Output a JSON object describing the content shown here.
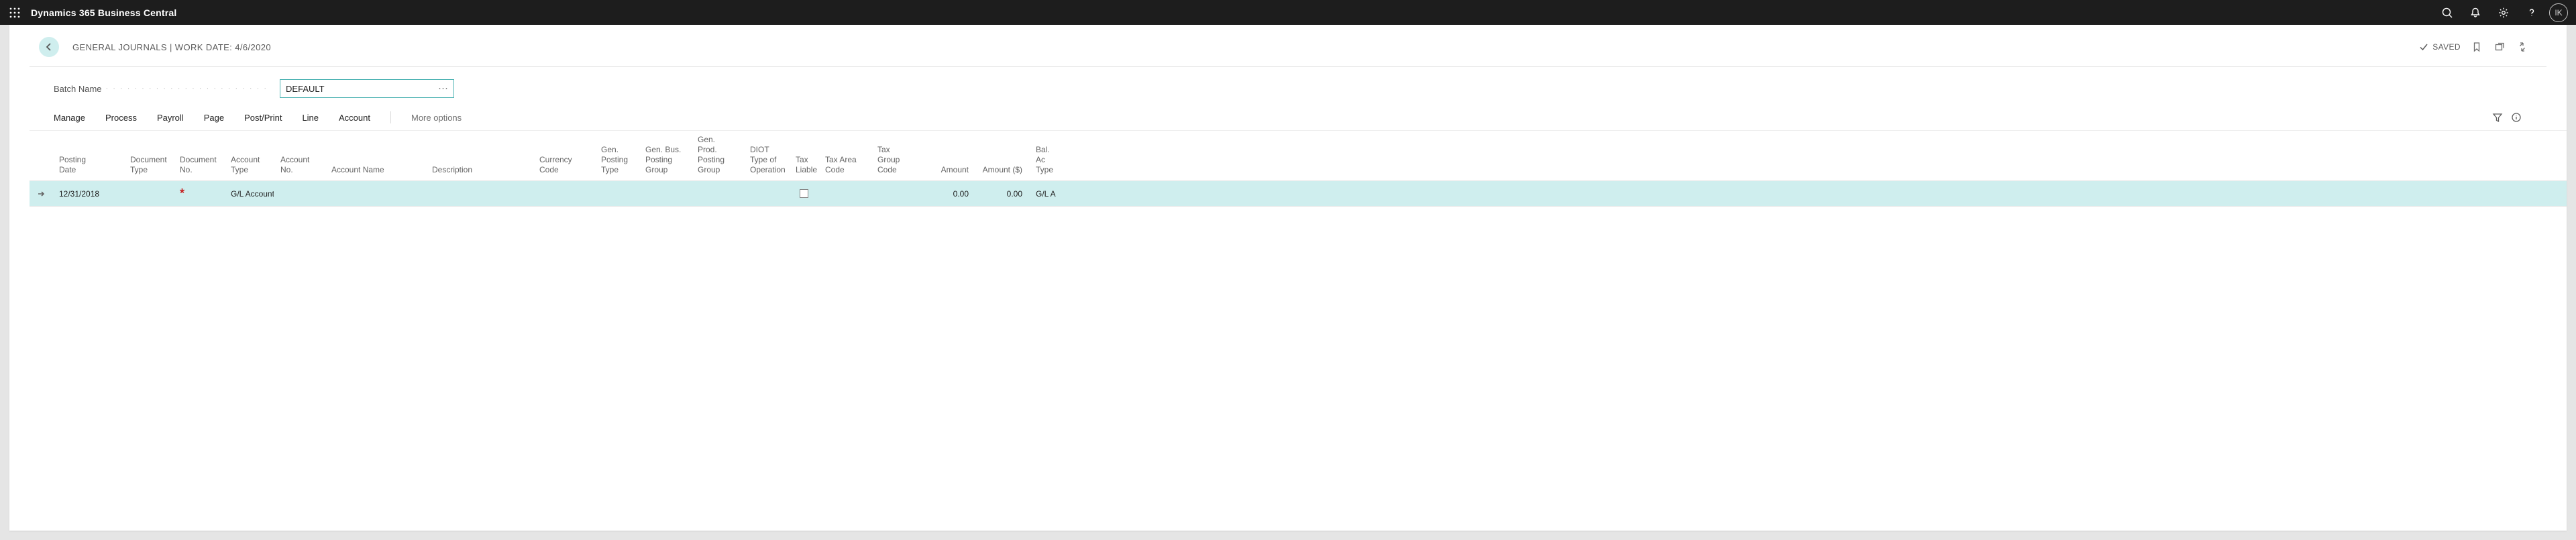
{
  "app": {
    "title": "Dynamics 365 Business Central",
    "avatar_initials": "IK"
  },
  "header": {
    "breadcrumb": "GENERAL JOURNALS | WORK DATE: 4/6/2020",
    "saved_label": "SAVED"
  },
  "fields": {
    "batch_name_label": "Batch Name",
    "batch_name_value": "DEFAULT"
  },
  "toolbar": {
    "manage": "Manage",
    "process": "Process",
    "payroll": "Payroll",
    "page": "Page",
    "post_print": "Post/Print",
    "line": "Line",
    "account": "Account",
    "more": "More options"
  },
  "grid": {
    "headers": {
      "posting_date": "Posting Date",
      "doc_type": "Document Type",
      "doc_no": "Document No.",
      "acct_type": "Account Type",
      "acct_no": "Account No.",
      "acct_name": "Account Name",
      "description": "Description",
      "currency": "Currency Code",
      "gen_posting": "Gen. Posting Type",
      "gen_bus": "Gen. Bus. Posting Group",
      "gen_prod": "Gen. Prod. Posting Group",
      "diot": "DIOT Type of Operation",
      "tax_liable": "Tax Liable",
      "tax_area": "Tax Area Code",
      "tax_group": "Tax Group Code",
      "amount": "Amount",
      "amount_usd": "Amount ($)",
      "bal_acct": "Bal. Ac Type"
    },
    "rows": [
      {
        "posting_date": "12/31/2018",
        "doc_type": "",
        "doc_no": "",
        "doc_no_required": true,
        "acct_type": "G/L Account",
        "acct_no": "",
        "acct_name": "",
        "description": "",
        "currency": "",
        "gen_posting": "",
        "gen_bus": "",
        "gen_prod": "",
        "diot": "",
        "tax_liable": false,
        "tax_area": "",
        "tax_group": "",
        "amount": "0.00",
        "amount_usd": "0.00",
        "bal_acct": "G/L A"
      }
    ]
  }
}
